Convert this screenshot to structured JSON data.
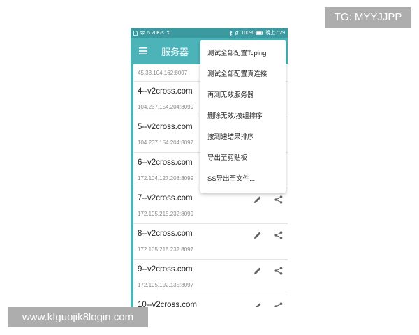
{
  "watermarks": {
    "top": "TG: MYYJJPP",
    "bottom": "www.kfguojik8login.com"
  },
  "statusbar": {
    "speed": "5.20K/s",
    "battery": "100%",
    "time": "晚上7:29"
  },
  "toolbar": {
    "menu_icon": "hamburger-menu-icon",
    "title": "服务器"
  },
  "servers": [
    {
      "name": "",
      "address": "45.33.104.162:8097"
    },
    {
      "name": "4--v2cross.com",
      "address": "104.237.154.204:8099"
    },
    {
      "name": "5--v2cross.com",
      "address": "104.237.154.204:8097"
    },
    {
      "name": "6--v2cross.com",
      "address": "172.104.127.208:8099"
    },
    {
      "name": "7--v2cross.com",
      "address": "172.105.215.232:8099"
    },
    {
      "name": "8--v2cross.com",
      "address": "172.105.215.232:8097"
    },
    {
      "name": "9--v2cross.com",
      "address": "172.105.192.135:8097"
    },
    {
      "name": "10--v2cross.com",
      "address": ""
    }
  ],
  "overflow_menu": {
    "items": [
      "测试全部配置Tcping",
      "测试全部配置真连接",
      "再测无效服务器",
      "删除无效/按组排序",
      "按测速结果排序",
      "导出至剪贴板",
      "SS导出至文件..."
    ]
  },
  "icons": {
    "edit": "pencil-edit-icon",
    "share": "share-icon",
    "fab": "paper-plane-connect-icon"
  },
  "colors": {
    "toolbar": "#4cb3b8",
    "statusbar": "#3a9aa0",
    "accent": "#4cb3b8"
  }
}
